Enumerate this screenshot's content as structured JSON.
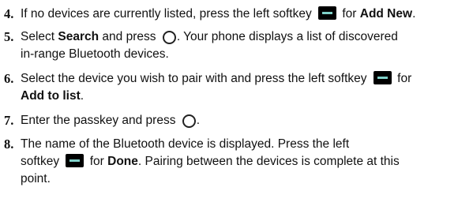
{
  "steps": [
    {
      "number": "4.",
      "lines": [
        {
          "t1": "If no devices are currently listed, press the left softkey",
          "t2": "for",
          "b": "Add New",
          "t3": "."
        }
      ]
    },
    {
      "number": "5.",
      "lines": [
        {
          "t1": "Select",
          "b": "Search",
          "t2": "and press",
          "t3": ". Your phone displays a list of discovered"
        },
        {
          "t1": "in-range Bluetooth devices."
        }
      ]
    },
    {
      "number": "6.",
      "lines": [
        {
          "t1": "Select the device you wish to pair with and press the left softkey",
          "t2": "for"
        },
        {
          "b": "Add to list",
          "t1": "."
        }
      ]
    },
    {
      "number": "7.",
      "lines": [
        {
          "t1": "Enter the passkey and press",
          "t2": "."
        }
      ]
    },
    {
      "number": "8.",
      "lines": [
        {
          "t1": "The name of the Bluetooth device is displayed. Press the left"
        },
        {
          "t1": "softkey",
          "t2": "for",
          "b": "Done",
          "t3": ". Pairing between the devices is complete at this"
        },
        {
          "t1": "point."
        }
      ]
    }
  ],
  "icons": {
    "softkey": "left-softkey-icon",
    "ok_key": "ok-key-circle-icon"
  }
}
